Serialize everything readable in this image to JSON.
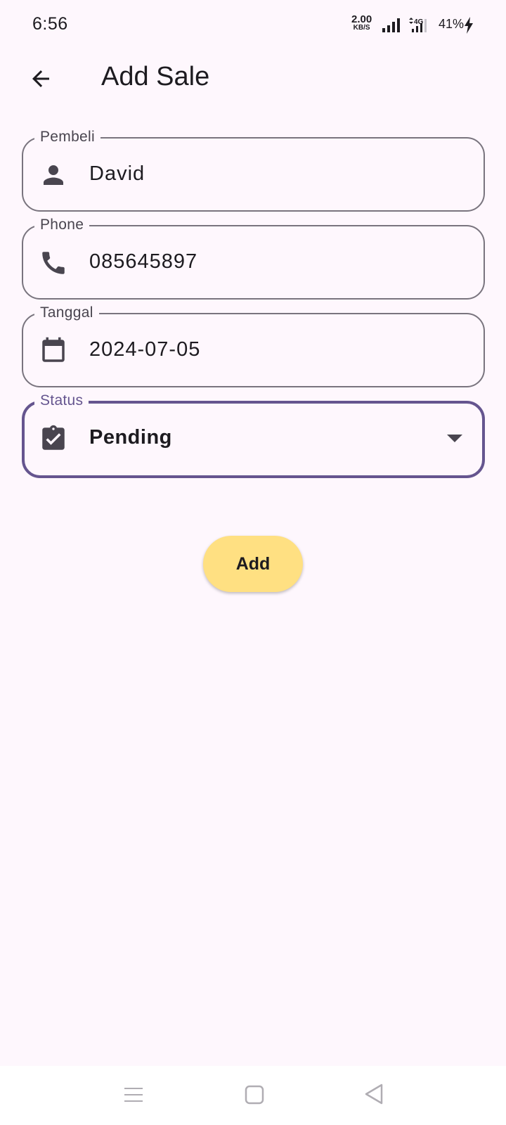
{
  "status_bar": {
    "time": "6:56",
    "net_speed_value": "2.00",
    "net_speed_unit": "KB/S",
    "network_type": "4G",
    "battery": "41%"
  },
  "app_bar": {
    "title": "Add Sale",
    "back_icon": "arrow-back-icon"
  },
  "form": {
    "buyer": {
      "label": "Pembeli",
      "value": "David",
      "icon": "person-icon"
    },
    "phone": {
      "label": "Phone",
      "value": "085645897",
      "icon": "phone-icon"
    },
    "date": {
      "label": "Tanggal",
      "value": "2024-07-05",
      "icon": "calendar-icon"
    },
    "status": {
      "label": "Status",
      "value": "Pending",
      "icon": "clipboard-check-icon"
    }
  },
  "add_button": {
    "label": "Add"
  },
  "colors": {
    "background": "#fef7fd",
    "primary": "#65558f",
    "outline": "#79747e",
    "button": "#ffe082"
  }
}
